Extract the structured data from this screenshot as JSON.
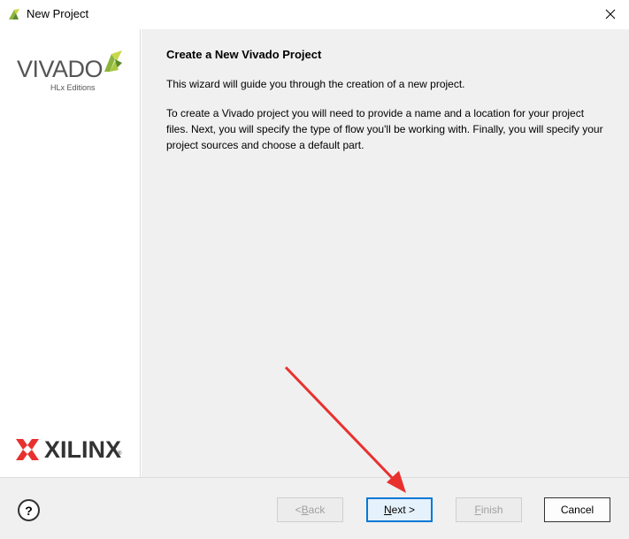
{
  "window": {
    "title": "New Project",
    "close_glyph": "✕"
  },
  "sidebar": {
    "vivado_logo": {
      "word": "VIVADO",
      "subtitle": "HLx Editions"
    },
    "xilinx_logo": {
      "word": "XILINX",
      "reg": "®"
    }
  },
  "content": {
    "heading": "Create a New Vivado Project",
    "intro": "This wizard will guide you through the creation of a new project.",
    "description": "To create a Vivado project you will need to provide a name and a location for your project files. Next, you will specify the type of flow you'll be working with. Finally, you will specify your project sources and choose a default part."
  },
  "footer": {
    "help_label": "?",
    "back": {
      "prefix": "< ",
      "mnemonic": "B",
      "rest": "ack",
      "enabled": false
    },
    "next": {
      "mnemonic": "N",
      "rest": "ext >",
      "enabled": true
    },
    "finish": {
      "mnemonic": "F",
      "rest": "inish",
      "enabled": false
    },
    "cancel": {
      "label": "Cancel",
      "enabled": true
    }
  },
  "colors": {
    "annotation_arrow": "#e8312f",
    "next_focus_border": "#0078d7",
    "vivado_green": "#8cb43c",
    "xilinx_red": "#e8312f"
  },
  "icons": {
    "app": "vivado-app-icon",
    "close": "close-icon",
    "help": "help-icon"
  }
}
